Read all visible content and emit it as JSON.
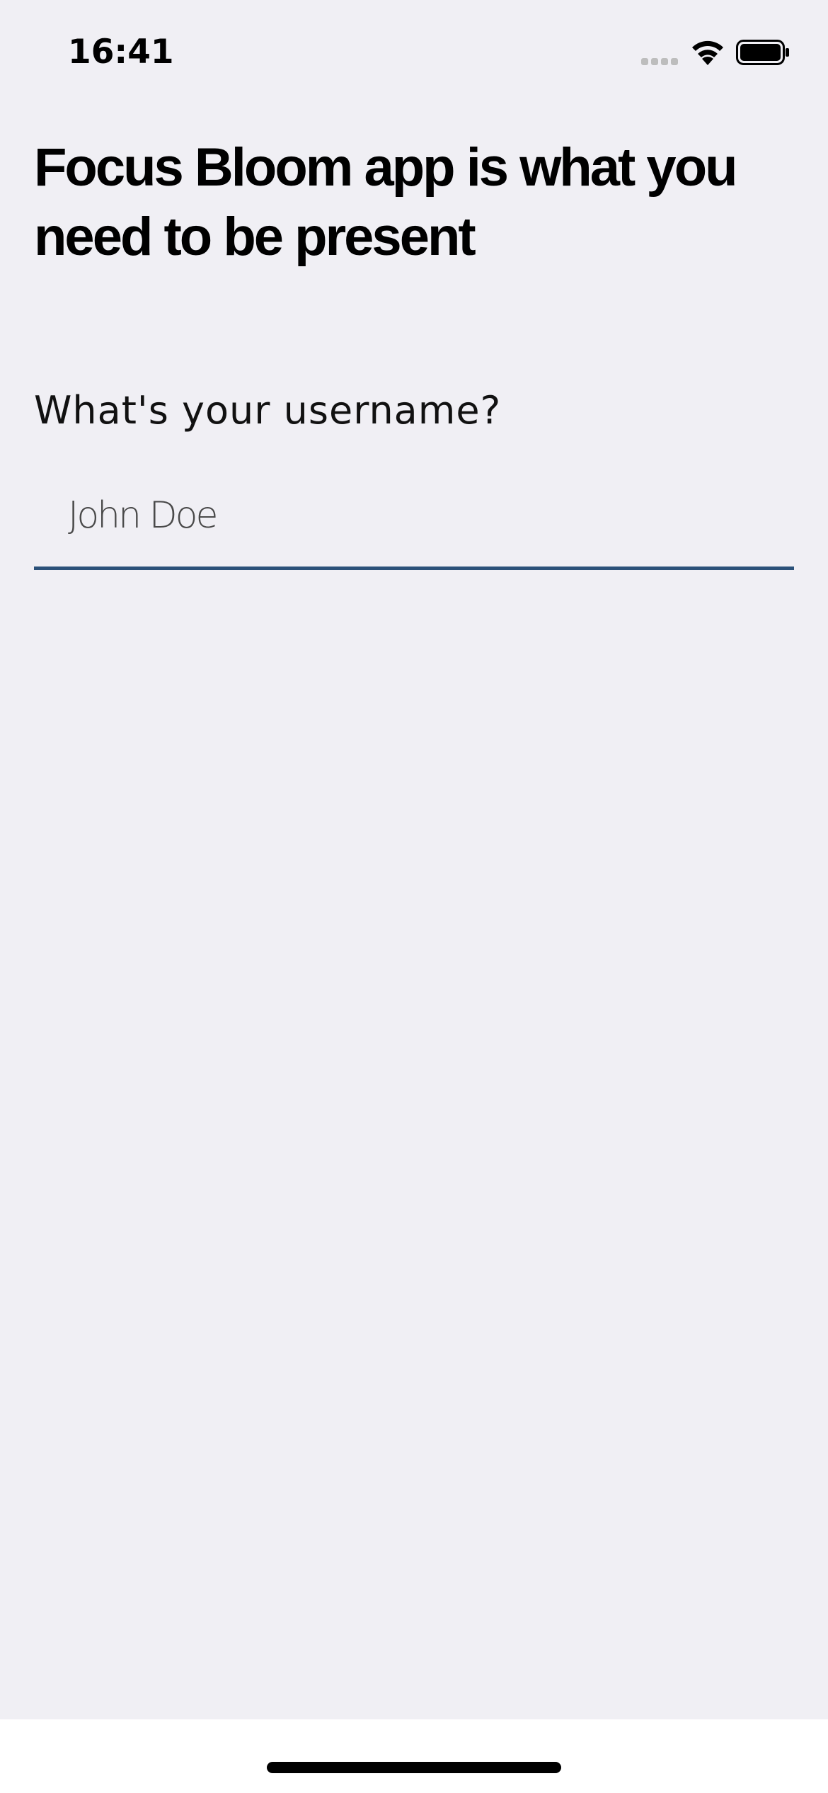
{
  "status_bar": {
    "time": "16:41",
    "icons": [
      "cellular-signal-icon",
      "wifi-icon",
      "battery-icon"
    ]
  },
  "onboarding": {
    "headline": "Focus Bloom app is what you need to be present",
    "question": "What's your username?",
    "username_field": {
      "value": "",
      "placeholder": "John Doe"
    }
  },
  "colors": {
    "background": "#f0eff4",
    "field_underline": "#2b5179",
    "home_area": "#ffffff"
  }
}
